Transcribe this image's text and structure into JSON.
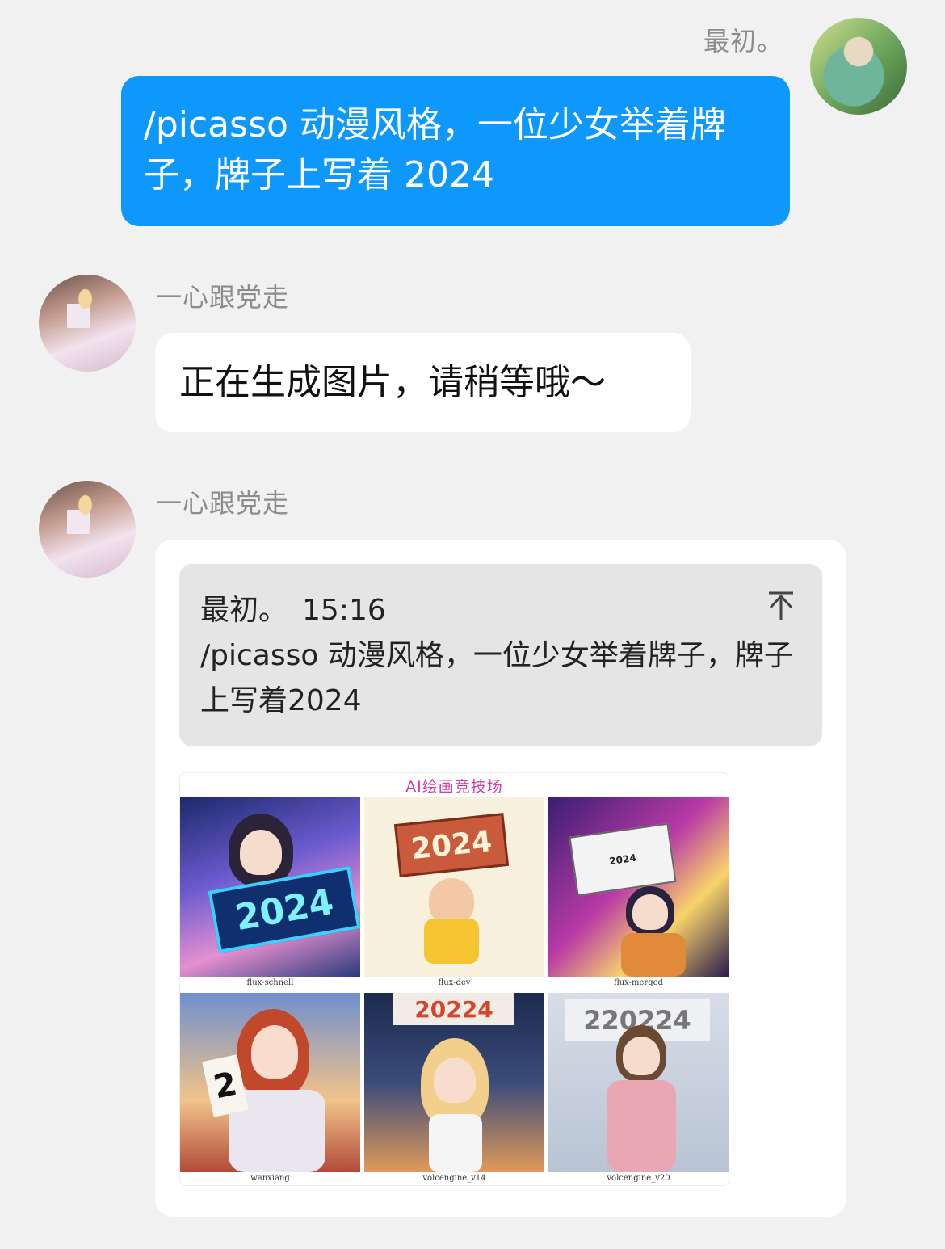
{
  "me": {
    "sender_name": "最初。",
    "message": "/picasso 动漫风格，一位少女举着牌子，牌子上写着 2024"
  },
  "bot": {
    "sender_name": "一心跟党走",
    "status_message": "正在生成图片，请稍等哦～",
    "reply": {
      "quote_sender": "最初。",
      "quote_time": "15:16",
      "quote_text": "/picasso 动漫风格，一位少女举着牌子，牌子上写着2024",
      "image": {
        "title": "AI绘画竞技场",
        "cells": [
          {
            "label": "flux-schnell",
            "sign_text": "2024"
          },
          {
            "label": "flux-dev",
            "sign_text": "2024"
          },
          {
            "label": "flux-merged",
            "sign_text": "2024"
          },
          {
            "label": "wanxiang",
            "sign_text": "2"
          },
          {
            "label": "volcengine_v14",
            "sign_text": "20224"
          },
          {
            "label": "volcengine_v20",
            "sign_text": "220224"
          }
        ]
      }
    }
  },
  "icons": {
    "collapse": "collapse-to-top-icon"
  },
  "colors": {
    "bubble_me": "#0e98fb",
    "background": "#f1f1f1",
    "quote_bg": "#e5e5e5",
    "grid_title": "#d23ea8"
  }
}
